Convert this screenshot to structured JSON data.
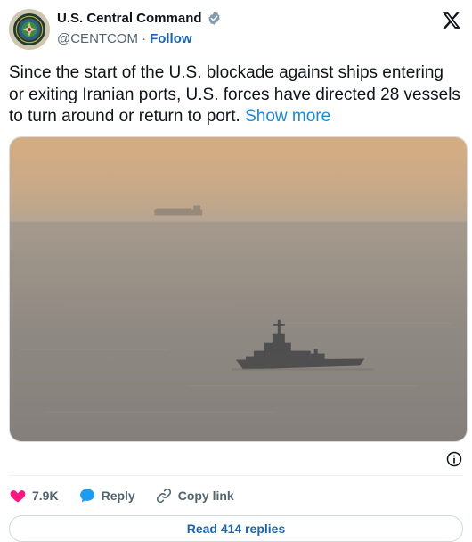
{
  "account": {
    "display_name": "U.S. Central Command",
    "handle": "@CENTCOM",
    "separator": "·",
    "follow_label": "Follow"
  },
  "tweet": {
    "text": "Since the start of the U.S. blockade against ships entering or exiting Iranian ports, U.S. forces have directed 28 vessels to turn around or return to port.",
    "show_more_label": "Show more"
  },
  "actions": {
    "likes_count": "7.9K",
    "reply_label": "Reply",
    "copy_link_label": "Copy link"
  },
  "read_replies_label": "Read 414 replies",
  "icons": {
    "avatar": "centcom-seal-icon",
    "verified": "verified-badge-icon",
    "platform": "x-logo-icon",
    "info": "info-icon",
    "like": "heart-icon",
    "reply": "reply-bubble-icon",
    "copy_link": "link-icon"
  },
  "colors": {
    "accent_link": "#1d64ad",
    "like_heart": "#f91880",
    "reply_bubble": "#1d9bf0",
    "muted_text": "#536471"
  }
}
